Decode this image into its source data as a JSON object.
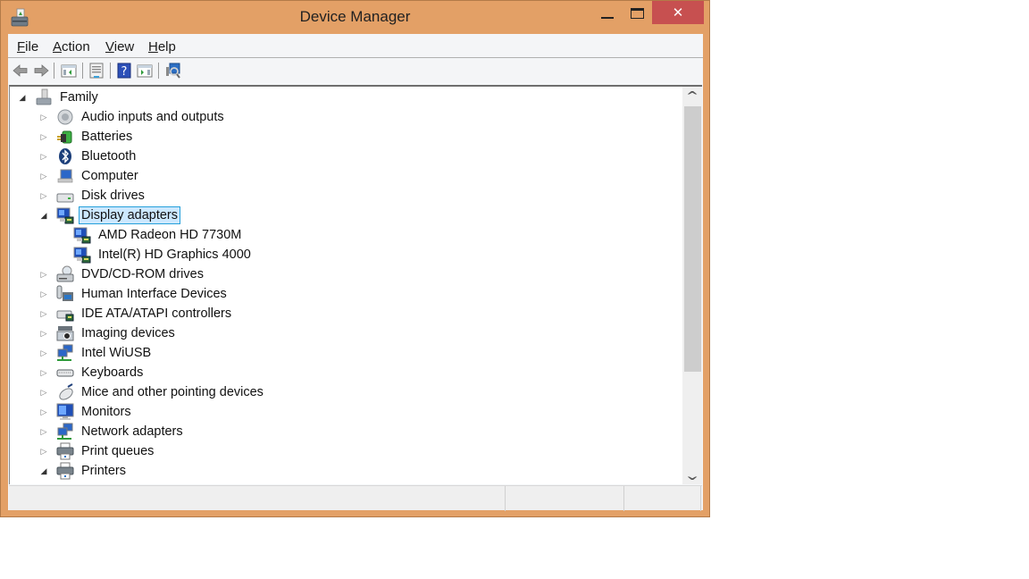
{
  "window": {
    "title": "Device Manager",
    "app_icon": "device-manager-icon",
    "controls": {
      "minimize": "minimize-icon",
      "maximize": "maximize-icon",
      "close_glyph": "✕"
    }
  },
  "colors": {
    "frame": "#e3a066",
    "close_button": "#c75050",
    "selection_fill": "#cce8ff",
    "selection_border": "#26a0da"
  },
  "menubar": {
    "items": [
      {
        "label_ul": "F",
        "label_rest": "ile"
      },
      {
        "label_ul": "A",
        "label_rest": "ction"
      },
      {
        "label_ul": "V",
        "label_rest": "iew"
      },
      {
        "label_ul": "H",
        "label_rest": "elp"
      }
    ]
  },
  "toolbar": {
    "buttons": [
      "back-icon",
      "forward-icon",
      "show-hide-console-tree-icon",
      "properties-icon",
      "help-icon",
      "show-action-pane-icon",
      "scan-hardware-changes-icon"
    ]
  },
  "tree": {
    "root": {
      "label": "Family",
      "expanded": true,
      "icon": "computer-tower-icon"
    },
    "items": [
      {
        "label": "Audio inputs and outputs",
        "expanded": false,
        "icon": "speaker-icon",
        "level": 1
      },
      {
        "label": "Batteries",
        "expanded": false,
        "icon": "battery-icon",
        "level": 1
      },
      {
        "label": "Bluetooth",
        "expanded": false,
        "icon": "bluetooth-icon",
        "level": 1
      },
      {
        "label": "Computer",
        "expanded": false,
        "icon": "computer-icon",
        "level": 1
      },
      {
        "label": "Disk drives",
        "expanded": false,
        "icon": "disk-drive-icon",
        "level": 1
      },
      {
        "label": "Display adapters",
        "expanded": true,
        "selected": true,
        "icon": "display-adapter-icon",
        "level": 1
      },
      {
        "label": "AMD Radeon HD 7730M",
        "icon": "display-adapter-icon",
        "level": 2
      },
      {
        "label": "Intel(R) HD Graphics 4000",
        "icon": "display-adapter-icon",
        "level": 2
      },
      {
        "label": "DVD/CD-ROM drives",
        "expanded": false,
        "icon": "dvd-drive-icon",
        "level": 1
      },
      {
        "label": "Human Interface Devices",
        "expanded": false,
        "icon": "hid-icon",
        "level": 1
      },
      {
        "label": "IDE ATA/ATAPI controllers",
        "expanded": false,
        "icon": "ide-controller-icon",
        "level": 1
      },
      {
        "label": "Imaging devices",
        "expanded": false,
        "icon": "camera-icon",
        "level": 1
      },
      {
        "label": "Intel WiUSB",
        "expanded": false,
        "icon": "network-icon",
        "level": 1
      },
      {
        "label": "Keyboards",
        "expanded": false,
        "icon": "keyboard-icon",
        "level": 1
      },
      {
        "label": "Mice and other pointing devices",
        "expanded": false,
        "icon": "mouse-icon",
        "level": 1
      },
      {
        "label": "Monitors",
        "expanded": false,
        "icon": "monitor-icon",
        "level": 1
      },
      {
        "label": "Network adapters",
        "expanded": false,
        "icon": "network-icon",
        "level": 1
      },
      {
        "label": "Print queues",
        "expanded": false,
        "icon": "printer-icon",
        "level": 1
      },
      {
        "label": "Printers",
        "expanded": true,
        "icon": "printer-icon",
        "level": 1
      }
    ]
  },
  "scrollbar": {
    "up": "⌃",
    "down": "⌄",
    "position_fraction": 0.0,
    "visible_fraction": 0.7
  },
  "statusbar": {
    "panes": [
      "",
      "",
      ""
    ]
  }
}
